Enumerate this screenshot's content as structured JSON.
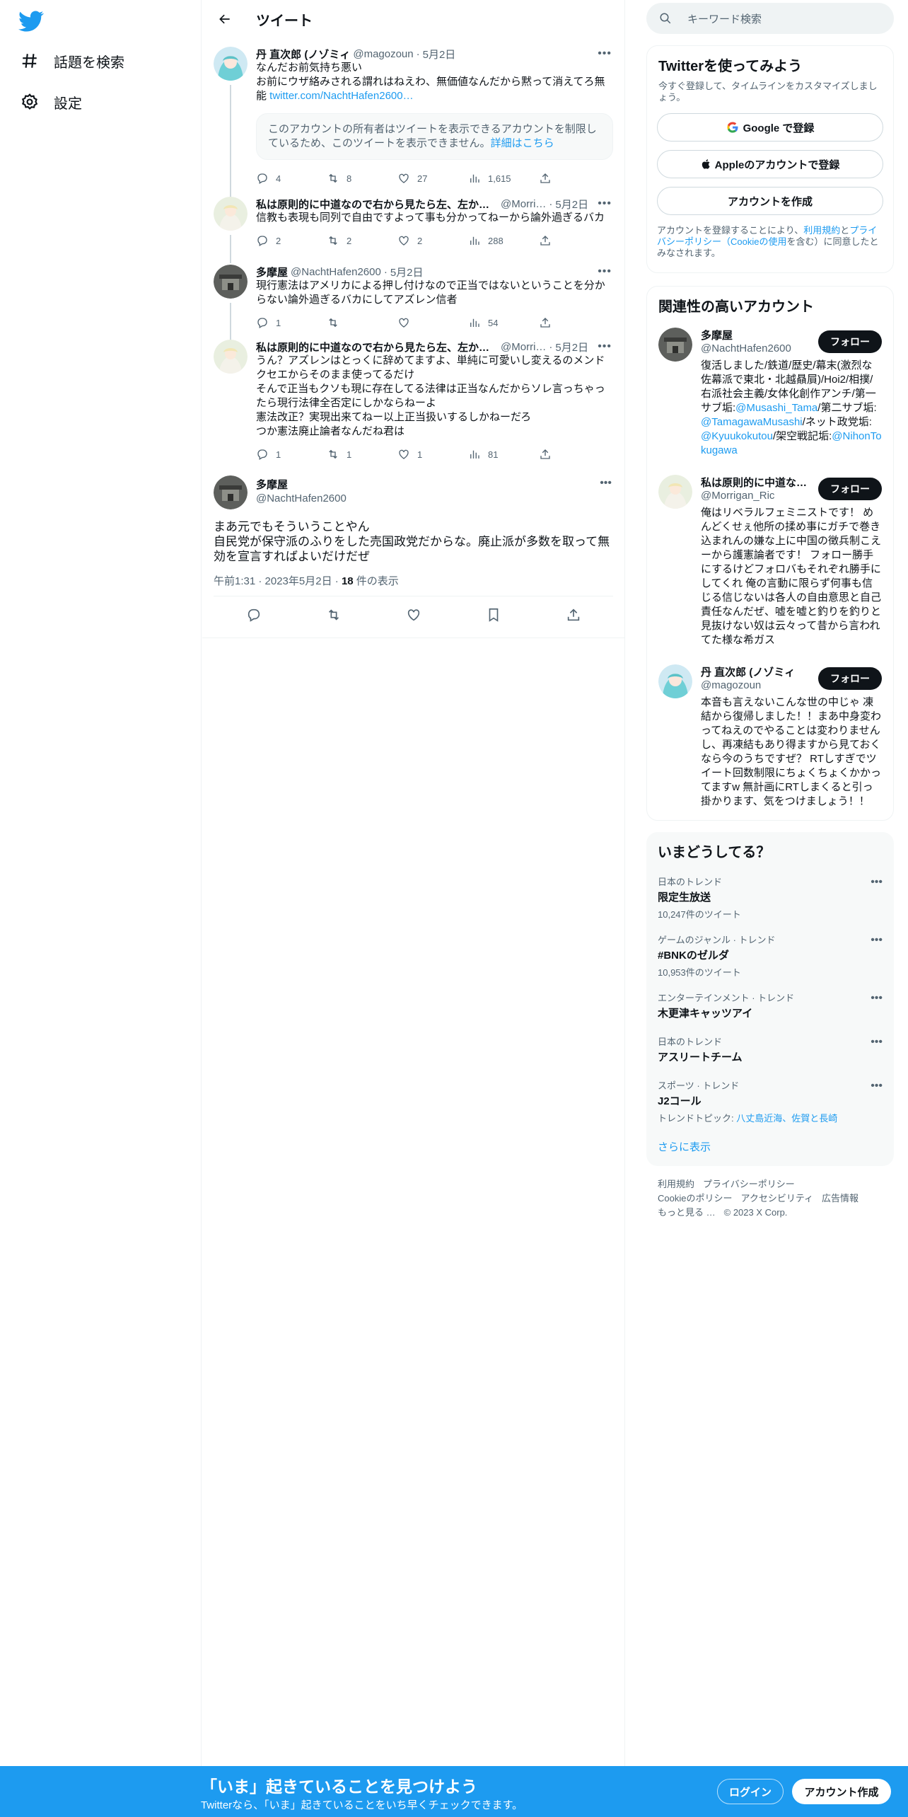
{
  "colors": {
    "accent": "#1d9bf0",
    "text": "#0f1419",
    "muted": "#536471"
  },
  "nav": {
    "logo": "twitter-bird-icon",
    "items": [
      {
        "label": "話題を検索",
        "icon": "hashtag-icon"
      },
      {
        "label": "設定",
        "icon": "gear-icon"
      }
    ]
  },
  "header": {
    "title": "ツイート"
  },
  "tweets": [
    {
      "name": "丹 直次郎 (ノゾミィ",
      "handle": "@magozoun",
      "sep": "·",
      "date": "5月2日",
      "text": "なんだお前気持ち悪い\nお前にウザ絡みされる謂れはねえわ、無価値なんだから黙って消えてろ無能 ",
      "link": "twitter.com/NachtHafen2600…",
      "notice": "このアカウントの所有者はツイートを表示できるアカウントを制限しているため、このツイートを表示できません。",
      "notice_link": "詳細はこちら",
      "replies": "4",
      "retweets": "8",
      "likes": "27",
      "views": "1,615"
    },
    {
      "name": "私は原則的に中道なので右から見たら左、左か…",
      "handle": "@Morri…",
      "sep": "·",
      "date": "5月2日",
      "text": "信教も表現も同列で自由ですよって事も分かってねーから論外過ぎるバカ",
      "replies": "2",
      "retweets": "2",
      "likes": "2",
      "views": "288"
    },
    {
      "name": "多摩屋",
      "handle": "@NachtHafen2600",
      "sep": "·",
      "date": "5月2日",
      "text": "現行憲法はアメリカによる押し付けなので正当ではないということを分からない論外過ぎるバカにしてアズレン信者",
      "replies": "1",
      "retweets": "",
      "likes": "",
      "views": "54"
    },
    {
      "name": "私は原則的に中道なので右から見たら左、左か…",
      "handle": "@Morri…",
      "sep": "·",
      "date": "5月2日",
      "text": "うん？アズレンはとっくに辞めてますよ、単純に可愛いし変えるのメンドクセエからそのまま使ってるだけ\nそんで正当もクソも現に存在してる法律は正当なんだからソレ言っちゃったら現行法律全否定にしかならねーよ\n憲法改正？実現出来てねー以上正当扱いするしかねーだろ\nつか憲法廃止論者なんだね君は",
      "replies": "1",
      "retweets": "1",
      "likes": "1",
      "views": "81"
    }
  ],
  "main_tweet": {
    "name": "多摩屋",
    "handle": "@NachtHafen2600",
    "text": "まあ元でもそういうことやん\n自民党が保守派のふりをした売国政党だからな。廃止派が多数を取って無効を宣言すればよいだけだぜ",
    "time": "午前1:31 · 2023年5月2日",
    "sep": "·",
    "views_count": "18",
    "views_label": " 件の表示"
  },
  "search": {
    "placeholder": "キーワード検索"
  },
  "signup_card": {
    "title": "Twitterを使ってみよう",
    "subtitle": "今すぐ登録して、タイムラインをカスタマイズしましょう。",
    "google": "Google で登録",
    "apple": "Appleのアカウントで登録",
    "create": "アカウントを作成",
    "legal_1": "アカウントを登録することにより、",
    "legal_terms": "利用規約",
    "legal_2": "と",
    "legal_privacy": "プライバシーポリシー（Cookieの使用",
    "legal_3": "を含む）に同意したとみなされます。"
  },
  "related": {
    "title": "関連性の高いアカウント",
    "follow_label": "フォロー",
    "accounts": [
      {
        "name": "多摩屋",
        "handle": "@NachtHafen2600",
        "bio_a": "復活しました/鉄道/歴史/幕末(激烈な佐幕派で東北・北越贔屓)/Hoi2/相撲/右派社会主義/女体化創作アンチ/第一サブ垢:",
        "bio_l1": "@Musashi_Tama",
        "bio_b": "/第二サブ垢:",
        "bio_l2": "@TamagawaMusashi",
        "bio_c": "/ネット政党垢:",
        "bio_l3": "@Kyuukokutou",
        "bio_d": "/架空戦記垢:",
        "bio_l4": "@NihonTokugawa"
      },
      {
        "name": "私は原則的に中道な…",
        "handle": "@Morrigan_Ric",
        "bio": "俺はリベラルフェミニストです！ めんどくせぇ他所の揉め事にガチで巻き込まれんの嫌な上に中国の徴兵制こえーから護憲論者です！ フォロー勝手にするけどフォロバもそれぞれ勝手にしてくれ 俺の言動に限らず何事も信じる信じないは各人の自由意思と自己責任なんだぜ、嘘を嘘と釣りを釣りと見抜けない奴は云々って昔から言われてた様な希ガス"
      },
      {
        "name": "丹 直次郎 (ノゾミィ",
        "handle": "@magozoun",
        "bio": "本音も言えないこんな世の中じゃ 凍結から復帰しました！！まあ中身変わってねえのでやることは変わりませんし、再凍結もあり得ますから見ておくなら今のうちですぜ？ RTしすぎでツイート回数制限にちょくちょくかかってますw 無計画にRTしまくると引っ掛かります、気をつけましょう！！"
      }
    ]
  },
  "trends": {
    "title": "いまどうしてる？",
    "items": [
      {
        "category": "日本のトレンド",
        "name": "限定生放送",
        "count": "10,247件のツイート"
      },
      {
        "category": "ゲームのジャンル · トレンド",
        "name": "#BNKのゼルダ",
        "count": "10,953件のツイート"
      },
      {
        "category": "エンターテインメント · トレンド",
        "name": "木更津キャッツアイ",
        "count": ""
      },
      {
        "category": "日本のトレンド",
        "name": "アスリートチーム",
        "count": ""
      },
      {
        "category": "スポーツ · トレンド",
        "name": "J2コール",
        "count": "",
        "topic_label": "トレンドトピック: ",
        "topic_value": "八丈島近海、佐賀と長崎"
      }
    ],
    "show_more": "さらに表示"
  },
  "footer": {
    "links": [
      "利用規約",
      "プライバシーポリシー",
      "Cookieのポリシー",
      "アクセシビリティ",
      "広告情報",
      "もっと見る …"
    ],
    "copyright": "© 2023 X Corp."
  },
  "bottom_bar": {
    "title": "「いま」起きていることを見つけよう",
    "subtitle": "Twitterなら、「いま」起きていることをいち早くチェックできます。",
    "login": "ログイン",
    "signup": "アカウント作成"
  }
}
